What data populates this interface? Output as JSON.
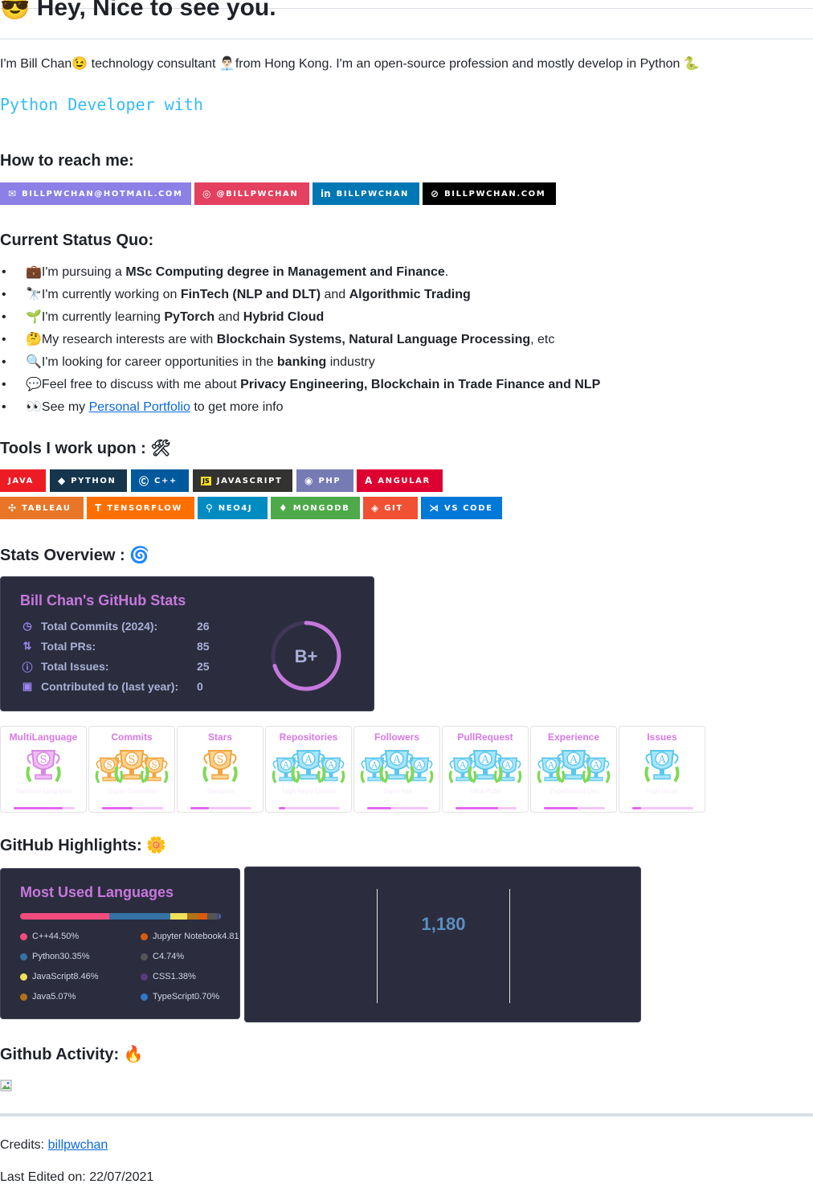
{
  "header": {
    "emoji": "😎",
    "title": "Hey, Nice to see you.",
    "intro_parts": [
      "I'm Bill Chan",
      "😉",
      " technology consultant ",
      "👨🏻‍💼",
      "from Hong Kong. I'm an open-source profession and mostly develop in Python ",
      "🐍"
    ],
    "typing_text": "Python Developer with"
  },
  "reach": {
    "heading": "How to reach me:",
    "badges": [
      {
        "label": "BILLPWCHAN@HOTMAIL.COM",
        "icon": "mail-icon",
        "glyph": "✉",
        "color": "#8C7FE6"
      },
      {
        "label": "@BILLPWCHAN",
        "icon": "instagram-icon",
        "glyph": "◎",
        "color": "#E4405F"
      },
      {
        "label": "BILLPWCHAN",
        "icon": "linkedin-icon",
        "glyph": "in",
        "color": "#0077B5"
      },
      {
        "label": "BILLPWCHAN.COM",
        "icon": "compass-icon",
        "glyph": "⊘",
        "color": "#000000"
      }
    ]
  },
  "status": {
    "heading": "Current Status Quo:",
    "items": [
      {
        "emoji": "💼",
        "pre": "I'm pursuing a ",
        "b1": "MSc Computing degree in Management and Finance",
        "mid": ".",
        "b2": "",
        "post": ""
      },
      {
        "emoji": "🔭",
        "pre": "I'm currently working on ",
        "b1": "FinTech (NLP and DLT)",
        "mid": " and ",
        "b2": "Algorithmic Trading",
        "post": ""
      },
      {
        "emoji": "🌱",
        "pre": "I'm currently learning ",
        "b1": "PyTorch",
        "mid": " and ",
        "b2": "Hybrid Cloud",
        "post": ""
      },
      {
        "emoji": "🤔",
        "pre": "My research interests are with ",
        "b1": "Blockchain Systems, Natural Language Processing",
        "mid": ", etc",
        "b2": "",
        "post": ""
      },
      {
        "emoji": "🔍",
        "pre": "I'm looking for career opportunities in the ",
        "b1": "banking",
        "mid": " industry",
        "b2": "",
        "post": ""
      },
      {
        "emoji": "💬",
        "pre": "Feel free to discuss with me about ",
        "b1": "Privacy Engineering, Blockchain in Trade Finance and NLP",
        "mid": "",
        "b2": "",
        "post": ""
      }
    ],
    "last_item": {
      "emoji": "👀",
      "pre": "See my ",
      "link": "Personal Portfolio",
      "post": " to get more info"
    }
  },
  "tools": {
    "heading": "Tools I work upon :",
    "heading_emoji": "🛠",
    "row1": [
      {
        "label": "JAVA",
        "icon": "java-icon",
        "glyph": "",
        "color": "#ED1C24"
      },
      {
        "label": "PYTHON",
        "icon": "python-icon",
        "glyph": "◆",
        "color": "#14354C"
      },
      {
        "label": "C++",
        "icon": "cpp-icon",
        "glyph": "Ⓒ",
        "color": "#00599C"
      },
      {
        "label": "JAVASCRIPT",
        "icon": "javascript-icon",
        "glyph": "JS",
        "color": "#323330"
      },
      {
        "label": "PHP",
        "icon": "php-icon",
        "glyph": "◉",
        "color": "#777BB4"
      },
      {
        "label": "ANGULAR",
        "icon": "angular-icon",
        "glyph": "A",
        "color": "#DD0031"
      }
    ],
    "row2": [
      {
        "label": "TABLEAU",
        "icon": "tableau-icon",
        "glyph": "✣",
        "color": "#E97627"
      },
      {
        "label": "TENSORFLOW",
        "icon": "tensorflow-icon",
        "glyph": "T",
        "color": "#FF6F00"
      },
      {
        "label": "NEO4J",
        "icon": "neo4j-icon",
        "glyph": "⚲",
        "color": "#008CC1"
      },
      {
        "label": "MONGODB",
        "icon": "mongodb-icon",
        "glyph": "♦",
        "color": "#4EA94B"
      },
      {
        "label": "GIT",
        "icon": "git-icon",
        "glyph": "◈",
        "color": "#F05033"
      },
      {
        "label": "VS CODE",
        "icon": "vscode-icon",
        "glyph": "⋊",
        "color": "#0078D7"
      }
    ]
  },
  "stats": {
    "heading": "Stats Overview :",
    "heading_emoji": "🌀",
    "card_title": "Bill Chan's GitHub Stats",
    "rows": [
      {
        "icon": "clock-icon",
        "glyph": "◷",
        "label": "Total Commits (2024):",
        "value": "26"
      },
      {
        "icon": "pull-request-icon",
        "glyph": "⇅",
        "label": "Total PRs:",
        "value": "85"
      },
      {
        "icon": "issue-icon",
        "glyph": "ⓘ",
        "label": "Total Issues:",
        "value": "25"
      },
      {
        "icon": "repo-icon",
        "glyph": "▣",
        "label": "Contributed to (last year):",
        "value": "0"
      }
    ],
    "grade": "B+",
    "grade_progress": 0.7,
    "trophies": [
      {
        "title": "MultiLanguage",
        "rank": "S",
        "progress": 0.8,
        "sub": "Rainbow Lang User",
        "style": "single-purple"
      },
      {
        "title": "Commits",
        "rank": "S",
        "progress": 0.5,
        "sub": "Super Committer",
        "style": "triple-gold"
      },
      {
        "title": "Stars",
        "rank": "S",
        "progress": 0.3,
        "sub": "Stargazer",
        "style": "single-gold"
      },
      {
        "title": "Repositories",
        "rank": "A",
        "progress": 0.1,
        "sub": "High Repo Creator",
        "style": "triple-blue"
      },
      {
        "title": "Followers",
        "rank": "A",
        "progress": 0.4,
        "sub": "Super Hot",
        "style": "triple-blue"
      },
      {
        "title": "PullRequest",
        "rank": "A",
        "progress": 0.7,
        "sub": "Ultra Puller",
        "style": "triple-blue"
      },
      {
        "title": "Experience",
        "rank": "A",
        "progress": 0.55,
        "sub": "Experienced Dev",
        "style": "triple-blue"
      },
      {
        "title": "Issues",
        "rank": "A",
        "progress": 0.15,
        "sub": "High Issuer",
        "style": "single-blue"
      }
    ]
  },
  "highlights": {
    "heading": "GitHub Highlights:",
    "heading_emoji": "🌼",
    "lang_title": "Most Used Languages",
    "languages": [
      {
        "name": "C++",
        "percent": 44.5,
        "label": "44.50%",
        "color": "#f34b7d"
      },
      {
        "name": "Python",
        "percent": 30.35,
        "label": "30.35%",
        "color": "#3572A5"
      },
      {
        "name": "JavaScript",
        "percent": 8.46,
        "label": "8.46%",
        "color": "#f1e05a"
      },
      {
        "name": "Java",
        "percent": 5.07,
        "label": "5.07%",
        "color": "#b07219"
      },
      {
        "name": "Jupyter Notebook",
        "percent": 4.81,
        "label": "4.81",
        "color": "#DA5B0B"
      },
      {
        "name": "C",
        "percent": 4.74,
        "label": "4.74%",
        "color": "#555555"
      },
      {
        "name": "CSS",
        "percent": 1.38,
        "label": "1.38%",
        "color": "#563d7c"
      },
      {
        "name": "TypeScript",
        "percent": 0.7,
        "label": "0.70%",
        "color": "#3178c6"
      }
    ],
    "streak_value": "1,180"
  },
  "activity": {
    "heading": "Github Activity:",
    "heading_emoji": "🔥",
    "broken_image_icon": "broken-image-icon"
  },
  "footer": {
    "credits_label": "Credits: ",
    "credits_link": "billpwchan",
    "last_edited": "Last Edited on: 22/07/2021"
  }
}
